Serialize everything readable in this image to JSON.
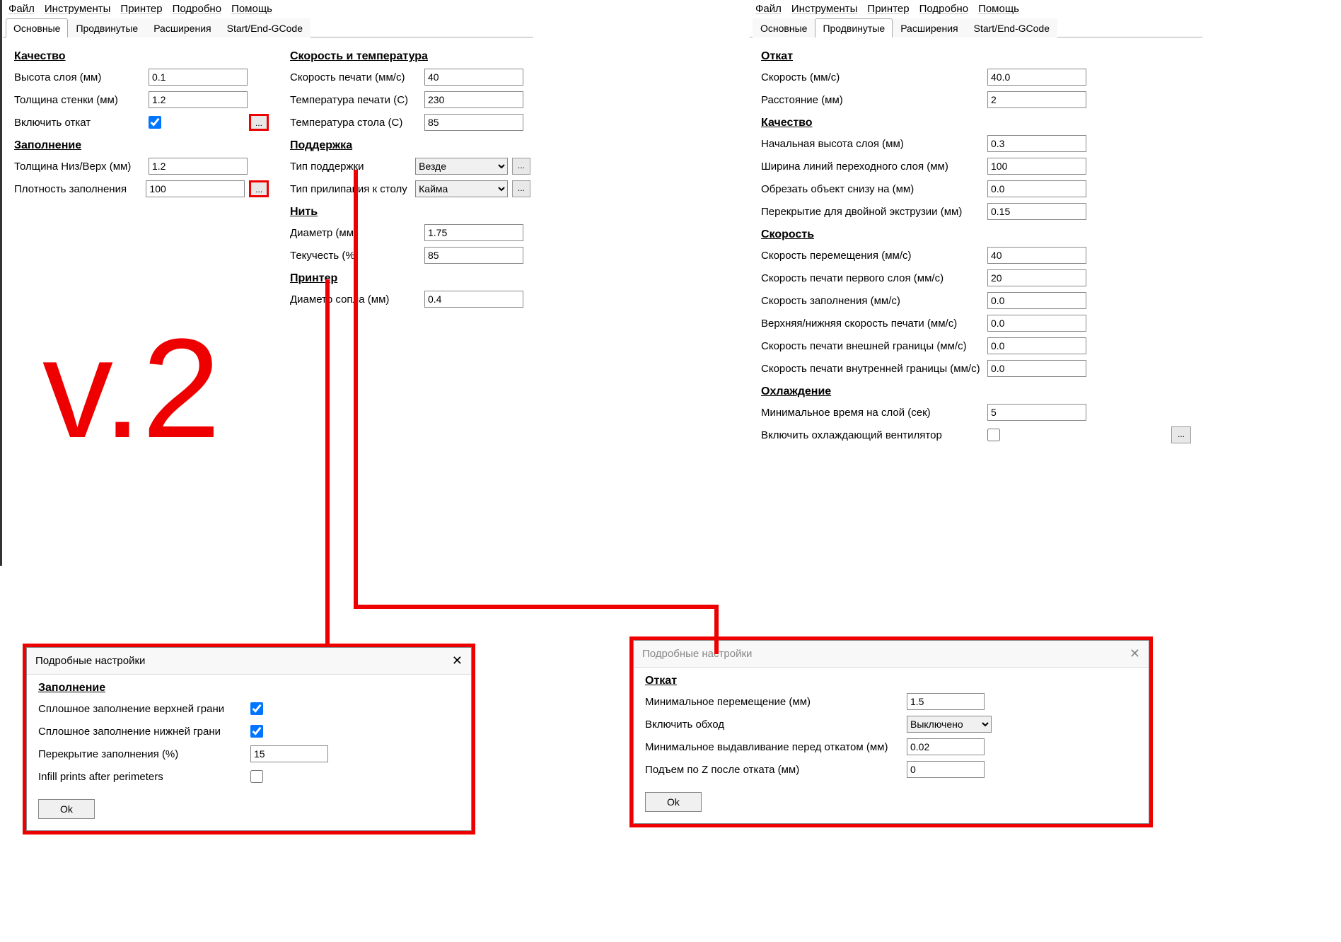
{
  "menu": {
    "file": "Файл",
    "tools": "Инструменты",
    "printer": "Принтер",
    "details": "Подробно",
    "help": "Помощь"
  },
  "tabs": {
    "basic": "Основные",
    "advanced": "Продвинутые",
    "plugins": "Расширения",
    "gcode": "Start/End-GCode"
  },
  "overlay_version": "v.2",
  "left": {
    "quality": {
      "title": "Качество",
      "layer_height_label": "Высота слоя (мм)",
      "layer_height": "0.1",
      "wall_thick_label": "Толщина стенки (мм)",
      "wall_thick": "1.2",
      "retract_label": "Включить откат",
      "retract_checked": true
    },
    "fill": {
      "title": "Заполнение",
      "bottom_top_label": "Толщина Низ/Верх (мм)",
      "bottom_top": "1.2",
      "density_label": "Плотность заполнения",
      "density": "100"
    },
    "speedtemp": {
      "title": "Скорость и температура",
      "print_speed_label": "Скорость печати (мм/с)",
      "print_speed": "40",
      "print_temp_label": "Температура печати (C)",
      "print_temp": "230",
      "bed_temp_label": "Температура стола (C)",
      "bed_temp": "85"
    },
    "support": {
      "title": "Поддержка",
      "type_label": "Тип поддержки",
      "type_value": "Везде",
      "adhesion_label": "Тип прилипания к столу",
      "adhesion_value": "Кайма"
    },
    "filament": {
      "title": "Нить",
      "diameter_label": "Диаметр (мм)",
      "diameter": "1.75",
      "flow_label": "Текучесть (%)",
      "flow": "85"
    },
    "printer": {
      "title": "Принтер",
      "nozzle_label": "Диаметр сопла (мм)",
      "nozzle": "0.4"
    }
  },
  "right": {
    "retract": {
      "title": "Откат",
      "speed_label": "Скорость (мм/с)",
      "speed": "40.0",
      "dist_label": "Расстояние (мм)",
      "dist": "2"
    },
    "quality": {
      "title": "Качество",
      "init_layer_label": "Начальная высота слоя (мм)",
      "init_layer": "0.3",
      "line_width_label": "Ширина линий переходного слоя (мм)",
      "line_width": "100",
      "cut_bottom_label": "Обрезать объект снизу на (мм)",
      "cut_bottom": "0.0",
      "dual_overlap_label": "Перекрытие для двойной экструзии (мм)",
      "dual_overlap": "0.15"
    },
    "speed": {
      "title": "Скорость",
      "travel_label": "Скорость перемещения (мм/с)",
      "travel": "40",
      "first_layer_label": "Скорость печати первого слоя (мм/с)",
      "first_layer": "20",
      "infill_label": "Скорость заполнения (мм/с)",
      "infill": "0.0",
      "topbot_label": "Верхняя/нижняя скорость печати (мм/с)",
      "topbot": "0.0",
      "outer_label": "Скорость печати внешней границы (мм/с)",
      "outer": "0.0",
      "inner_label": "Скорость печати внутренней границы (мм/с)",
      "inner": "0.0"
    },
    "cooling": {
      "title": "Охлаждение",
      "min_time_label": "Минимальное время на слой (сек)",
      "min_time": "5",
      "fan_label": "Включить охлаждающий вентилятор",
      "fan_checked": false
    }
  },
  "popup_fill": {
    "title": "Подробные настройки",
    "section": "Заполнение",
    "solid_top_label": "Сплошное заполнение верхней грани",
    "solid_top": true,
    "solid_bottom_label": "Сплошное заполнение нижней грани",
    "solid_bottom": true,
    "overlap_label": "Перекрытие заполнения (%)",
    "overlap": "15",
    "after_perim_label": "Infill prints after perimeters",
    "after_perim": false,
    "ok": "Ok"
  },
  "popup_retract": {
    "title": "Подробные настройки",
    "section": "Откат",
    "min_travel_label": "Минимальное перемещение (мм)",
    "min_travel": "1.5",
    "combing_label": "Включить обход",
    "combing_value": "Выключено",
    "min_extrude_label": "Минимальное выдавливание перед откатом (мм)",
    "min_extrude": "0.02",
    "zhop_label": "Подъем по Z после отката (мм)",
    "zhop": "0",
    "ok": "Ok"
  }
}
